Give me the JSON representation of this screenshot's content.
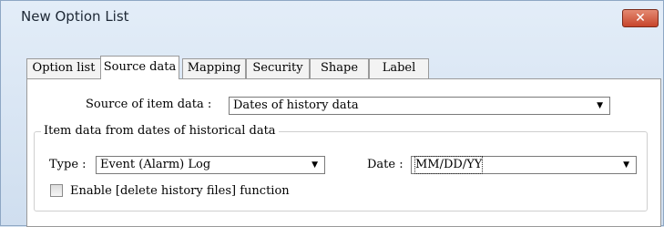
{
  "window": {
    "title": "New Option List",
    "close_glyph": "✕"
  },
  "tabs": [
    {
      "label": "Option list",
      "active": false
    },
    {
      "label": "Source data",
      "active": true
    },
    {
      "label": "Mapping",
      "active": false
    },
    {
      "label": "Security",
      "active": false
    },
    {
      "label": "Shape",
      "active": false
    },
    {
      "label": "Label",
      "active": false
    }
  ],
  "source": {
    "label": "Source of item data :",
    "value": "Dates of history data"
  },
  "history_group": {
    "title": "Item data from dates of historical data",
    "type_label": "Type :",
    "type_value": "Event (Alarm) Log",
    "date_label": "Date :",
    "date_value": "MM/DD/YY",
    "checkbox_label": "Enable [delete history files] function",
    "checkbox_checked": false
  },
  "icons": {
    "dropdown_arrow": "▼",
    "close": "close-icon"
  }
}
